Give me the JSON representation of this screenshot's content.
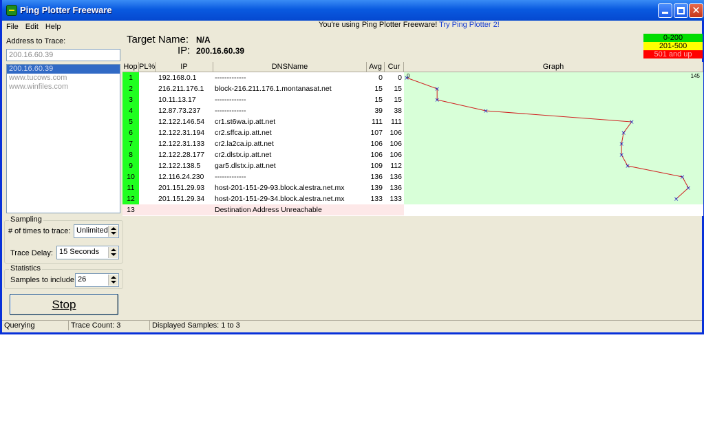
{
  "window": {
    "title": "Ping Plotter Freeware"
  },
  "menu": [
    "File",
    "Edit",
    "Help"
  ],
  "promo": {
    "text": "You're using Ping Plotter Freeware!",
    "link": "Try Ping Plotter 2!"
  },
  "left": {
    "address_label": "Address to Trace:",
    "address_value": "200.16.60.39",
    "history": [
      "200.16.60.39",
      "www.tucows.com",
      "www.winfiles.com"
    ],
    "sampling_title": "Sampling",
    "times_label": "# of times to trace:",
    "times_value": "Unlimited",
    "delay_label": "Trace Delay:",
    "delay_value": "15 Seconds",
    "statistics_title": "Statistics",
    "samples_label": "Samples to include:",
    "samples_value": "26",
    "stop_label": "Stop"
  },
  "target": {
    "name_label": "Target Name:",
    "name_value": "N/A",
    "ip_label": "IP:",
    "ip_value": "200.16.60.39"
  },
  "legend": [
    {
      "label": "0-200",
      "color": "#00dd00"
    },
    {
      "label": "201-500",
      "color": "#ffff00"
    },
    {
      "label": "501 and up",
      "color": "#ff0000"
    }
  ],
  "table": {
    "headers": [
      "Hop",
      "PL%",
      "IP",
      "DNSName",
      "Avg",
      "Cur",
      "Graph"
    ],
    "graph_scale_left": "0",
    "graph_scale_right": "145",
    "rows": [
      {
        "hop": "1",
        "pl": "",
        "ip": "192.168.0.1",
        "dns": "-------------",
        "avg": "0",
        "cur": "0"
      },
      {
        "hop": "2",
        "pl": "",
        "ip": "216.211.176.1",
        "dns": "block-216.211.176.1.montanasat.net",
        "avg": "15",
        "cur": "15"
      },
      {
        "hop": "3",
        "pl": "",
        "ip": "10.11.13.17",
        "dns": "-------------",
        "avg": "15",
        "cur": "15"
      },
      {
        "hop": "4",
        "pl": "",
        "ip": "12.87.73.237",
        "dns": "-------------",
        "avg": "39",
        "cur": "38"
      },
      {
        "hop": "5",
        "pl": "",
        "ip": "12.122.146.54",
        "dns": "cr1.st6wa.ip.att.net",
        "avg": "111",
        "cur": "111"
      },
      {
        "hop": "6",
        "pl": "",
        "ip": "12.122.31.194",
        "dns": "cr2.sffca.ip.att.net",
        "avg": "107",
        "cur": "106"
      },
      {
        "hop": "7",
        "pl": "",
        "ip": "12.122.31.133",
        "dns": "cr2.la2ca.ip.att.net",
        "avg": "106",
        "cur": "106"
      },
      {
        "hop": "8",
        "pl": "",
        "ip": "12.122.28.177",
        "dns": "cr2.dlstx.ip.att.net",
        "avg": "106",
        "cur": "106"
      },
      {
        "hop": "9",
        "pl": "",
        "ip": "12.122.138.5",
        "dns": "gar5.dlstx.ip.att.net",
        "avg": "109",
        "cur": "112"
      },
      {
        "hop": "10",
        "pl": "",
        "ip": "12.116.24.230",
        "dns": "-------------",
        "avg": "136",
        "cur": "136"
      },
      {
        "hop": "11",
        "pl": "",
        "ip": "201.151.29.93",
        "dns": "host-201-151-29-93.block.alestra.net.mx",
        "avg": "139",
        "cur": "136"
      },
      {
        "hop": "12",
        "pl": "",
        "ip": "201.151.29.34",
        "dns": "host-201-151-29-34.block.alestra.net.mx",
        "avg": "133",
        "cur": "133"
      }
    ],
    "unreachable_hop": "13",
    "unreachable_text": "Destination Address Unreachable"
  },
  "status": {
    "state": "Querying",
    "trace_count": "Trace Count: 3",
    "samples": "Displayed Samples: 1 to 3"
  }
}
